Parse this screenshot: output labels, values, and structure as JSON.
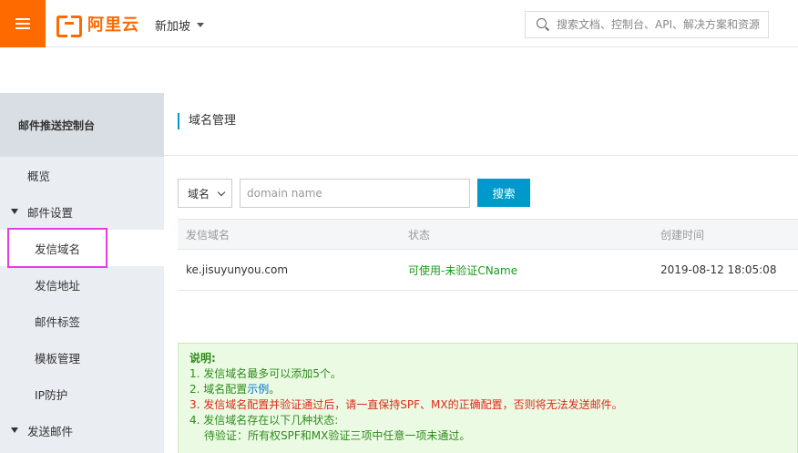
{
  "header": {
    "logo_text": "阿里云",
    "region": "新加坡",
    "search_placeholder": "搜索文档、控制台、API、解决方案和资源"
  },
  "sidebar": {
    "title": "邮件推送控制台",
    "overview": "概览",
    "mail_settings": "邮件设置",
    "items": [
      "发信域名",
      "发信地址",
      "邮件标签",
      "模板管理",
      "IP防护"
    ],
    "send_mail": "发送邮件"
  },
  "main": {
    "page_title": "域名管理",
    "filter_select": "域名",
    "input_placeholder": "domain name",
    "search_button": "搜索",
    "columns": [
      "发信域名",
      "状态",
      "创建时间"
    ],
    "rows": [
      {
        "domain": "ke.jisuyunyou.com",
        "status": "可使用-未验证CName",
        "created": "2019-08-12 18:05:08"
      }
    ],
    "notice": {
      "title": "说明:",
      "line1": "1. 发信域名最多可以添加5个。",
      "line2_prefix": "2. 域名配置",
      "line2_link": "示例",
      "line2_suffix": "。",
      "line3": "3. 发信域名配置并验证通过后，请一直保持SPF、MX的正确配置，否则将无法发送邮件。",
      "line4": "4. 发信域名存在以下几种状态:",
      "line5": "待验证：所有权SPF和MX验证三项中任意一项未通过。"
    }
  },
  "colors": {
    "brand": "#ff6a00",
    "primary": "#0099cc",
    "status_ok": "#1a9a1a",
    "notice_red": "#e0291b",
    "highlight": "#e63ce6"
  }
}
